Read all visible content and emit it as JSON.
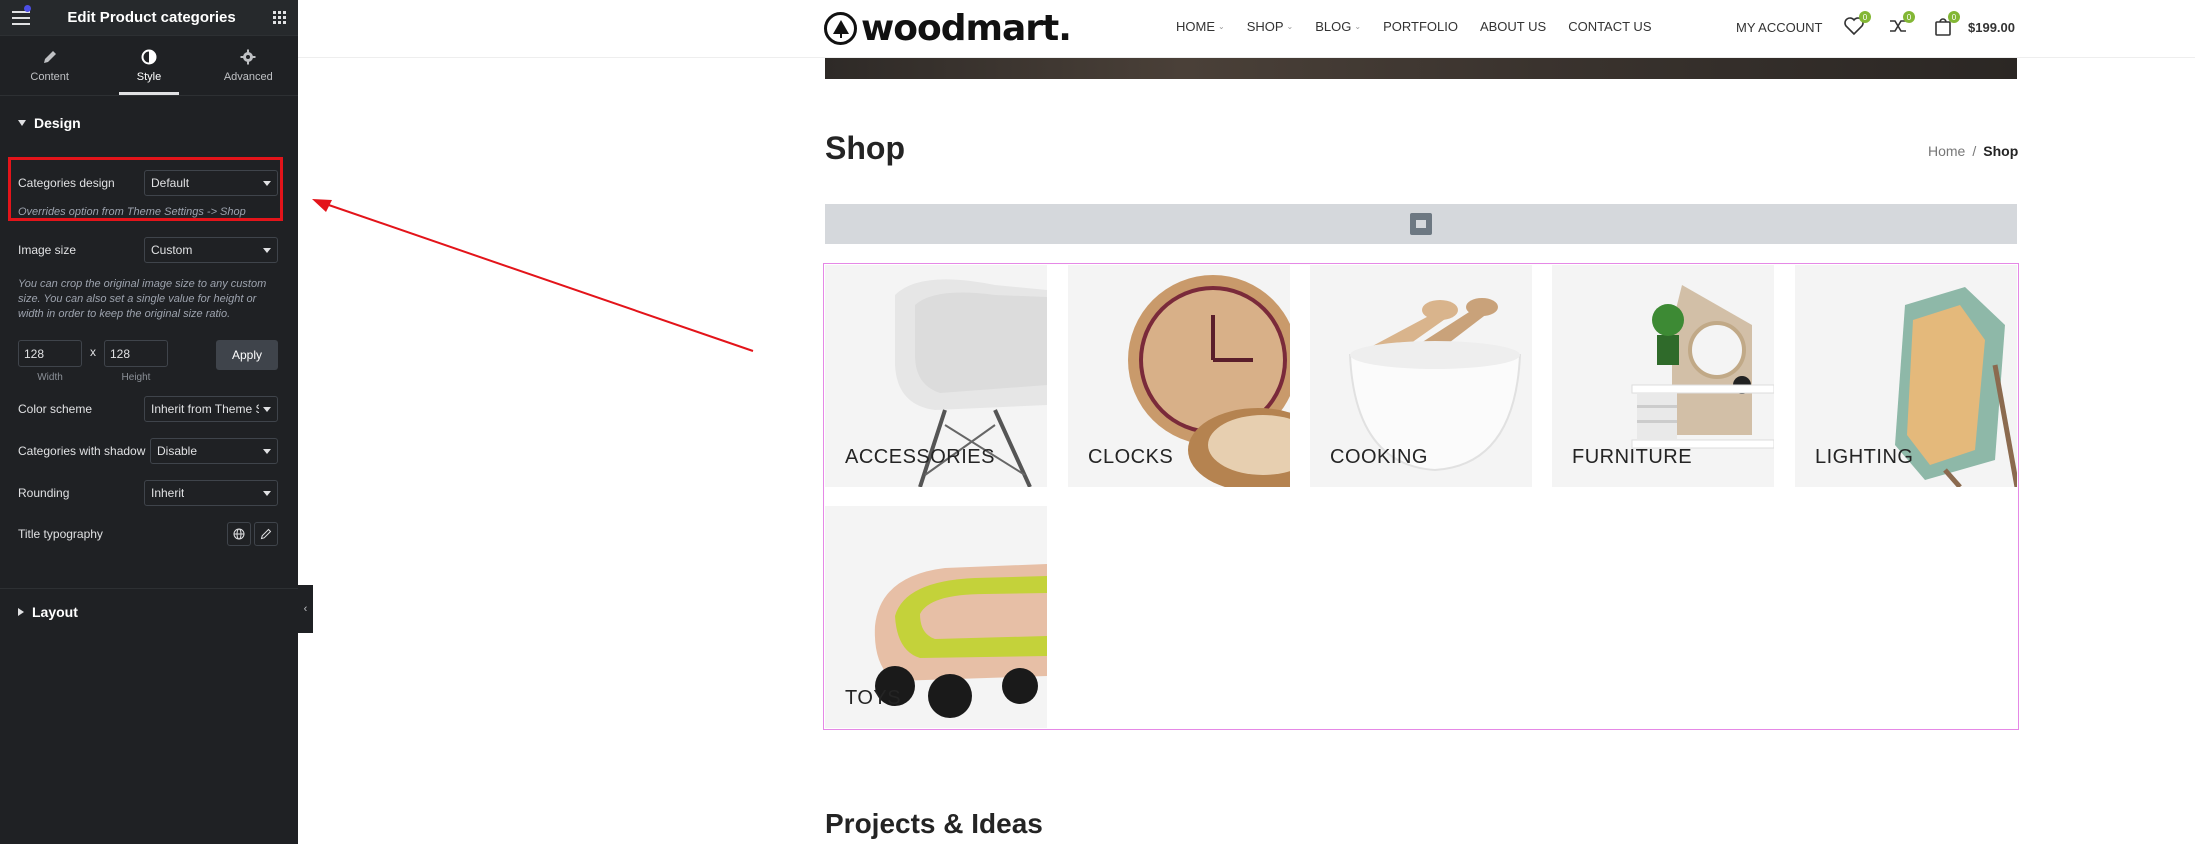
{
  "editor": {
    "title": "Edit Product categories",
    "tabs": [
      {
        "label": "Content",
        "icon": "pencil-icon"
      },
      {
        "label": "Style",
        "icon": "contrast-icon"
      },
      {
        "label": "Advanced",
        "icon": "gear-icon"
      }
    ],
    "design_section": "Design",
    "layout_section": "Layout",
    "controls": {
      "categories_design": {
        "label": "Categories design",
        "value": "Default",
        "note": "Overrides option from Theme Settings -> Shop"
      },
      "image_size": {
        "label": "Image size",
        "value": "Custom",
        "note": "You can crop the original image size to any custom size. You can also set a single value for height or width in order to keep the original size ratio."
      },
      "width": {
        "value": "128",
        "label": "Width"
      },
      "height": {
        "value": "128",
        "label": "Height"
      },
      "separator": "x",
      "apply_label": "Apply",
      "color_scheme": {
        "label": "Color scheme",
        "value": "Inherit from Theme Settings"
      },
      "shadow": {
        "label": "Categories with shadow",
        "value": "Disable"
      },
      "rounding": {
        "label": "Rounding",
        "value": "Inherit"
      },
      "title_typography": {
        "label": "Title typography"
      }
    },
    "collapse_glyph": "‹"
  },
  "site": {
    "logo": "woodmart.",
    "nav": [
      {
        "label": "HOME",
        "dropdown": true
      },
      {
        "label": "SHOP",
        "dropdown": true
      },
      {
        "label": "BLOG",
        "dropdown": true
      },
      {
        "label": "PORTFOLIO",
        "dropdown": false
      },
      {
        "label": "ABOUT US",
        "dropdown": false
      },
      {
        "label": "CONTACT US",
        "dropdown": false
      }
    ],
    "account": "MY ACCOUNT",
    "wishlist_count": "0",
    "compare_count": "0",
    "cart_count": "0",
    "cart_total": "$199.00",
    "page_title": "Shop",
    "breadcrumb": {
      "home": "Home",
      "sep": "/",
      "current": "Shop"
    },
    "categories": [
      "ACCESSORIES",
      "CLOCKS",
      "COOKING",
      "FURNITURE",
      "LIGHTING",
      "TOYS"
    ],
    "projects_title": "Projects & Ideas"
  },
  "colors": {
    "highlight": "#e3141a",
    "accent_badge": "#83b735",
    "panel_bg": "#1f2124",
    "selection_border": "#e588e6"
  }
}
